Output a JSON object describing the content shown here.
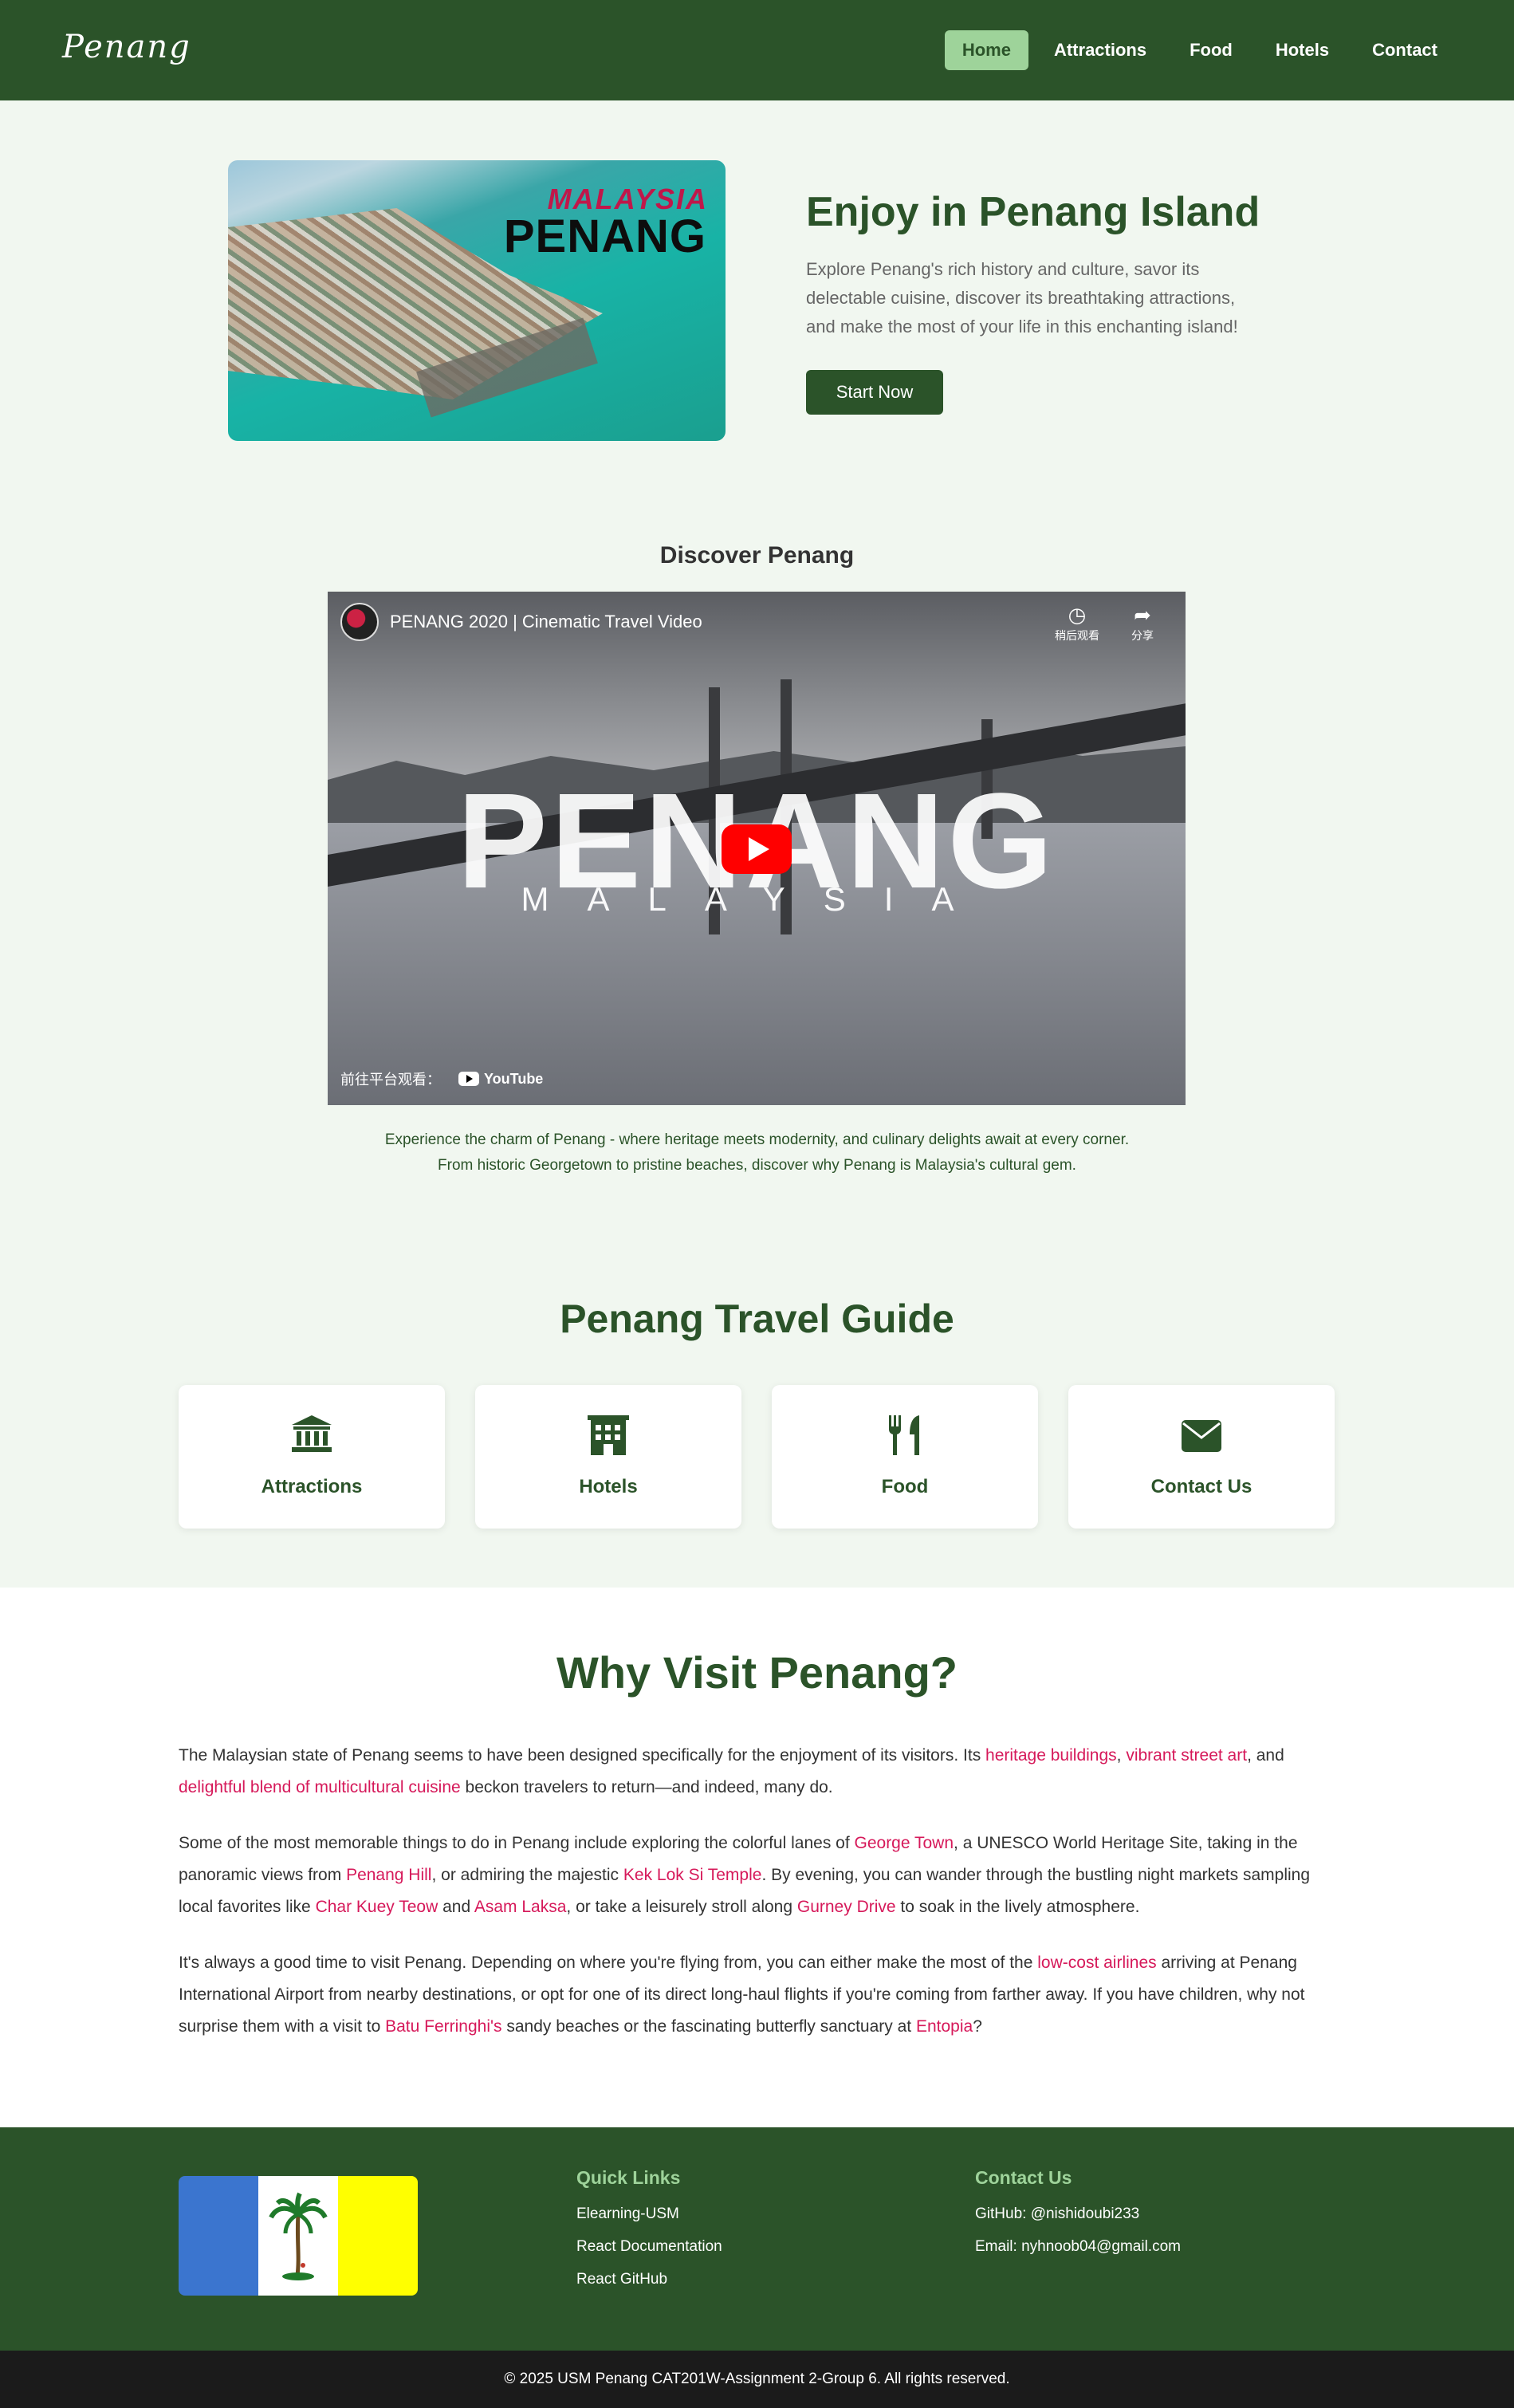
{
  "nav": {
    "brand": "Penang",
    "links": [
      "Home",
      "Attractions",
      "Food",
      "Hotels",
      "Contact"
    ]
  },
  "hero": {
    "image_text_top": "MALAYSIA",
    "image_text_main": "PENANG",
    "title": "Enjoy in Penang Island",
    "description": "Explore Penang's rich history and culture, savor its delectable cuisine, discover its breathtaking attractions, and make the most of your life in this enchanting island!",
    "button": "Start Now"
  },
  "discover": {
    "title": "Discover Penang",
    "video": {
      "title": "PENANG 2020 | Cinematic Travel Video",
      "action_watch_later": "稍后观看",
      "action_share": "分享",
      "overlay_main": "PENANG",
      "overlay_sub": "MALAYSIA",
      "watch_on": "前往平台观看：",
      "platform": "YouTube"
    },
    "caption_line1": "Experience the charm of Penang - where heritage meets modernity, and culinary delights await at every corner.",
    "caption_line2": "From historic Georgetown to pristine beaches, discover why Penang is Malaysia's cultural gem."
  },
  "guide": {
    "title": "Penang Travel Guide",
    "cards": [
      {
        "label": "Attractions",
        "icon": "landmark-icon"
      },
      {
        "label": "Hotels",
        "icon": "building-icon"
      },
      {
        "label": "Food",
        "icon": "utensils-icon"
      },
      {
        "label": "Contact Us",
        "icon": "envelope-icon"
      }
    ]
  },
  "why": {
    "title": "Why Visit Penang?",
    "p1": {
      "t1": "The Malaysian state of Penang seems to have been designed specifically for the enjoyment of its visitors. Its ",
      "l1": "heritage buildings",
      "t2": ", ",
      "l2": "vibrant street art",
      "t3": ", and ",
      "l3": "delightful blend of multicultural cuisine",
      "t4": " beckon travelers to return—and indeed, many do."
    },
    "p2": {
      "t1": "Some of the most memorable things to do in Penang include exploring the colorful lanes of ",
      "l1": "George Town",
      "t2": ", a UNESCO World Heritage Site, taking in the panoramic views from ",
      "l2": "Penang Hill",
      "t3": ", or admiring the majestic ",
      "l3": "Kek Lok Si Temple",
      "t4": ". By evening, you can wander through the bustling night markets sampling local favorites like ",
      "l4": "Char Kuey Teow",
      "t5": " and ",
      "l5": "Asam Laksa",
      "t6": ", or take a leisurely stroll along ",
      "l6": "Gurney Drive",
      "t7": " to soak in the lively atmosphere."
    },
    "p3": {
      "t1": "It's always a good time to visit Penang. Depending on where you're flying from, you can either make the most of the ",
      "l1": "low-cost airlines",
      "t2": " arriving at Penang International Airport from nearby destinations, or opt for one of its direct long-haul flights if you're coming from farther away. If you have children, why not surprise them with a visit to ",
      "l2": "Batu Ferringhi's",
      "t3": " sandy beaches or the fascinating butterfly sanctuary at ",
      "l3": "Entopia",
      "t4": "?"
    }
  },
  "footer": {
    "quick_links_title": "Quick Links",
    "quick_links": [
      "Elearning-USM",
      "React Documentation",
      "React GitHub"
    ],
    "contact_title": "Contact Us",
    "github": "GitHub: @nishidoubi233",
    "email": "Email: nyhnoob04@gmail.com",
    "copyright": "© 2025 USM Penang CAT201W-Assignment 2-Group 6. All rights reserved."
  },
  "colors": {
    "primary_green": "#2b5329",
    "light_green_bg": "#f1f7f0",
    "nav_active": "#9ed39a",
    "link_pink": "#d6195a",
    "copyright_bg": "#1b1b1b",
    "flag_blue": "#3b75cf",
    "flag_yellow": "#ffff00"
  }
}
